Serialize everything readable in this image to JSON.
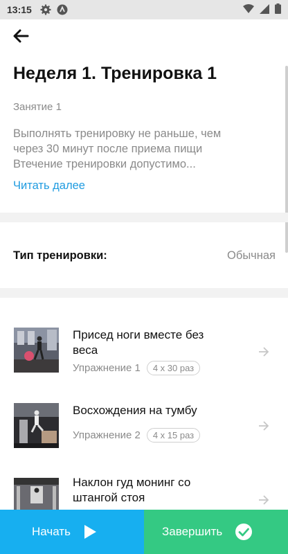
{
  "status_bar": {
    "time": "13:15"
  },
  "header": {
    "title": "Неделя 1. Тренировка 1",
    "lesson": "Занятие 1",
    "description_lines": [
      "Выполнять тренировку не раньше, чем",
      "через  30 минут после приема пищи",
      "Втечение тренировки допустимо..."
    ],
    "read_more": "Читать далее"
  },
  "training_type": {
    "label": "Тип тренировки:",
    "value": "Обычная"
  },
  "exercises": [
    {
      "name_lines": [
        "Присед ноги вместе без",
        "веса"
      ],
      "number": "Упражнение 1",
      "reps": "4 x 30 раз"
    },
    {
      "name_lines": [
        "Восхождения на тумбу"
      ],
      "number": "Упражнение 2",
      "reps": "4 x 15 раз"
    },
    {
      "name_lines": [
        "Наклон гуд монинг со",
        "штангой стоя"
      ],
      "number": "",
      "reps": ""
    }
  ],
  "actions": {
    "start": "Начать",
    "finish": "Завершить"
  },
  "colors": {
    "link": "#1e9be0",
    "start_button": "#17aff0",
    "finish_button": "#34c983",
    "muted_text": "#8a8a8a"
  },
  "icons": {
    "back": "arrow-left-icon",
    "play": "play-icon",
    "check": "check-circle-icon",
    "row_arrow": "arrow-right-icon"
  }
}
